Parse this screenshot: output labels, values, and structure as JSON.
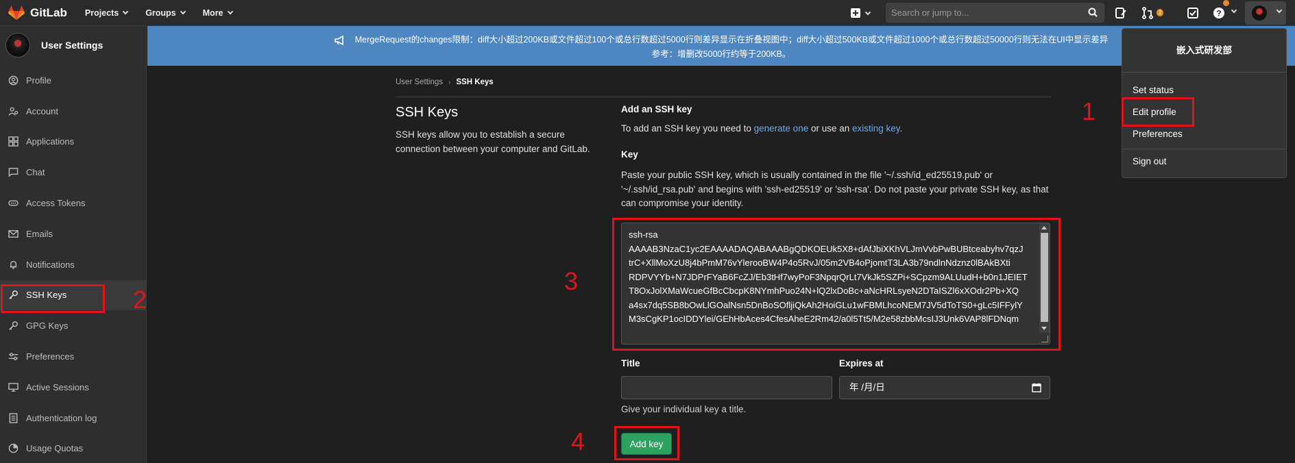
{
  "navbar": {
    "brand": "GitLab",
    "menu": [
      "Projects",
      "Groups",
      "More"
    ],
    "search_placeholder": "Search or jump to...",
    "mr_count": "2"
  },
  "sidebar": {
    "title": "User Settings",
    "items": [
      {
        "label": "Profile",
        "icon": "profile-icon"
      },
      {
        "label": "Account",
        "icon": "account-icon"
      },
      {
        "label": "Applications",
        "icon": "applications-icon"
      },
      {
        "label": "Chat",
        "icon": "chat-icon"
      },
      {
        "label": "Access Tokens",
        "icon": "token-icon"
      },
      {
        "label": "Emails",
        "icon": "mail-icon"
      },
      {
        "label": "Notifications",
        "icon": "bell-icon"
      },
      {
        "label": "SSH Keys",
        "icon": "key-icon"
      },
      {
        "label": "GPG Keys",
        "icon": "key-icon"
      },
      {
        "label": "Preferences",
        "icon": "preferences-icon"
      },
      {
        "label": "Active Sessions",
        "icon": "monitor-icon"
      },
      {
        "label": "Authentication log",
        "icon": "log-icon"
      },
      {
        "label": "Usage Quotas",
        "icon": "quota-icon"
      }
    ],
    "active_item": "SSH Keys"
  },
  "banner": {
    "line1": "MergeRequest的changes限制：diff大小超过200KB或文件超过100个或总行数超过5000行则差异显示在折叠视图中；diff大小超过500KB或文件超过1000个或总行数超过50000行则无法在UI中显示差异",
    "line2": "参考：增删改5000行约等于200KB。"
  },
  "breadcrumb": {
    "parent": "User Settings",
    "current": "SSH Keys"
  },
  "page": {
    "title": "SSH Keys",
    "description": "SSH keys allow you to establish a secure connection between your computer and GitLab."
  },
  "form": {
    "heading": "Add an SSH key",
    "intro_prefix": "To add an SSH key you need to ",
    "intro_link1": "generate one",
    "intro_middle": " or use an ",
    "intro_link2": "existing key",
    "intro_suffix": ".",
    "key_label": "Key",
    "key_help": "Paste your public SSH key, which is usually contained in the file '~/.ssh/id_ed25519.pub' or '~/.ssh/id_rsa.pub' and begins with 'ssh-ed25519' or 'ssh-rsa'. Do not paste your private SSH key, as that can compromise your identity.",
    "key_value_lines": [
      "ssh-rsa",
      "AAAAB3NzaC1yc2EAAAADAQABAAABgQDKOEUk5X8+dAfJbiXKhVLJmVvbPwBUBtceabyhv7qzJ",
      "trC+XllMoXzU8j4bPmM76vYlerooBW4P4o5RvJ/05m2VB4oPjomtT3LA3b79ndlnNdznz0lBAkBXti",
      "RDPVYYb+N7JDPrFYaB6FcZJ/Eb3tHf7wyPoF3NpqrQrLt7VkJk5SZPi+SCpzm9ALUudH+b0n1JEIET",
      "T8OxJolXMaWcueGfBcCbcpK8NYmhPuo24N+lQ2lxDoBc+aNcHRLsyeN2DTaISZl6xXOdr2Pb+XQ",
      "a4sx7dq5SB8bOwLlGOalNsn5DnBoSOfljiQkAh2HoiGLu1wFBMLhcoNEM7JV5dToTS0+gLc5IFFylY",
      "M3sCgKP1ocIDDYlei/GEhHbAces4CfesAheE2Rm42/a0l5Tt5/M2e58zbbMcsIJ3Unk6VAP8lFDNqm"
    ],
    "title_label": "Title",
    "title_value": "",
    "expires_label": "Expires at",
    "expires_value": "年 /月/日",
    "title_help": "Give your individual key a title.",
    "submit_label": "Add key"
  },
  "dropdown": {
    "user_name": "嵌入式研发部",
    "items": [
      "Set status",
      "Edit profile",
      "Preferences",
      "Sign out"
    ]
  },
  "annotations": [
    "1",
    "2",
    "3",
    "4"
  ],
  "colors": {
    "annotation": "#e0141b",
    "banner": "#4d86c0",
    "button": "#2da160",
    "link": "#6ea8e8"
  }
}
